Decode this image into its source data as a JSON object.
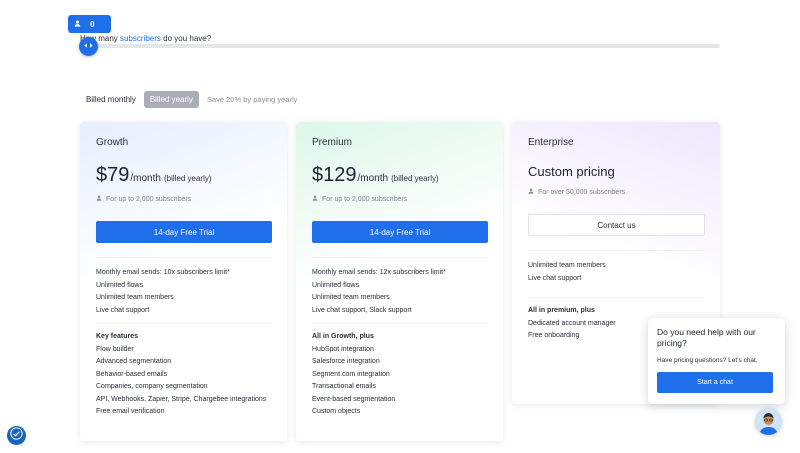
{
  "slider": {
    "value": "0",
    "question_prefix": "How many ",
    "question_highlight": "subscribers",
    "question_suffix": " do you have?",
    "user_icon": "user-icon",
    "handle_icon": "drag-arrows-icon",
    "accent": "#1f6feb"
  },
  "billing": {
    "monthly_label": "Billed monthly",
    "yearly_label": "Billed yearly",
    "note": "Save 20% by paying yearly",
    "selected": "Billed yearly"
  },
  "plans": {
    "growth": {
      "name": "Growth",
      "price": "$79",
      "per": "/month",
      "billed": "(billed yearly)",
      "subscribers": "For up to 2,000 subscribers",
      "cta": "14-day Free Trial",
      "features": [
        "Monthly email sends: 10x subscribers limit*",
        "Unlimited flows",
        "Unlimited team members",
        "Live chat support"
      ],
      "section_title": "Key features",
      "section_items": [
        "Flow builder",
        "Advanced segmentation",
        "Behavior-based emails",
        "Companies, company segmentation",
        "API, Webhooks, Zapier, Stripe, Chargebee integrations",
        "Free email verification"
      ]
    },
    "premium": {
      "name": "Premium",
      "price": "$129",
      "per": "/month",
      "billed": "(billed yearly)",
      "subscribers": "For up to 2,000 subscribers",
      "cta": "14-day Free Trial",
      "features": [
        "Monthly email sends: 12x subscribers limit*",
        "Unlimited flows",
        "Unlimited team members",
        "Live chat support, Slack support"
      ],
      "section_title": "All in Growth, plus",
      "section_items": [
        "HubSpot integration",
        "Salesforce integration",
        "Segment.com integration",
        "Transactional emails",
        "Event-based segmentation",
        "Custom objects"
      ]
    },
    "enterprise": {
      "name": "Enterprise",
      "price": "Custom pricing",
      "subscribers": "For over 50,000 subscribers",
      "cta": "Contact us",
      "features": [
        "Unlimited team members",
        "Live chat support"
      ],
      "section_title": "All in premium, plus",
      "section_items": [
        "Dedicated account manager",
        "Free onboarding"
      ]
    }
  },
  "chat": {
    "title": "Do you need help with our pricing?",
    "subtitle": "Have pricing questions? Let's chat.",
    "button": "Start a chat",
    "avatar_icon": "support-agent-avatar"
  },
  "accessibility": {
    "icon": "accessibility-icon",
    "color": "#1565c0"
  }
}
